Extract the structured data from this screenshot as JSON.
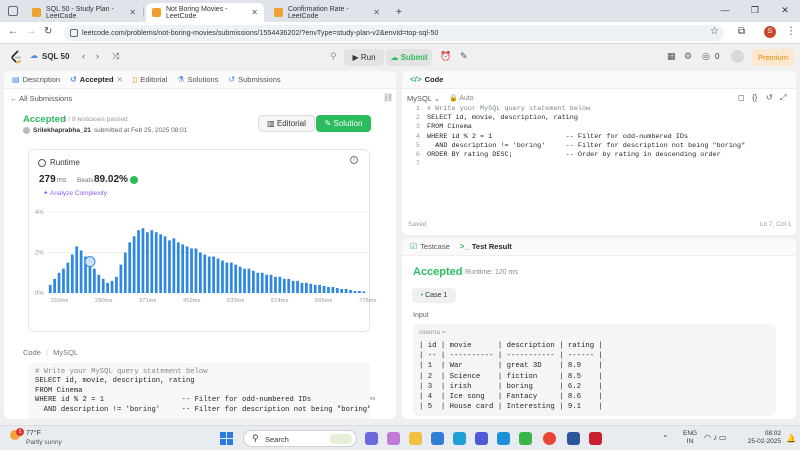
{
  "browser": {
    "tabs": [
      {
        "title": "SQL 50 - Study Plan - LeetCode",
        "active": false
      },
      {
        "title": "Not Boring Movies - LeetCode",
        "active": true
      },
      {
        "title": "Confirmation Rate - LeetCode",
        "active": false
      }
    ],
    "new_tab": "+",
    "url": "leetcode.com/problems/not-boring-movies/submissions/1554436202/?envType=study-plan-v2&envId=top-sql-50",
    "profile_initial": "S"
  },
  "header": {
    "study_plan": "SQL 50",
    "run_label": "Run",
    "submit_label": "Submit",
    "notif_count": "0",
    "premium_label": "Premium"
  },
  "left": {
    "tabs": [
      {
        "label": "Description",
        "icon": "description-icon"
      },
      {
        "label": "Accepted",
        "icon": "history-icon"
      },
      {
        "label": "Editorial",
        "icon": "editorial-icon"
      },
      {
        "label": "Solutions",
        "icon": "solutions-icon"
      },
      {
        "label": "Submissions",
        "icon": "submissions-icon"
      }
    ],
    "all_submissions": "All Submissions",
    "status": "Accepted",
    "passed": "8 / 8 testcases passed",
    "author": "Srilekhaprabha_21",
    "submitted_at": "submitted at Feb 25, 2025 08:01",
    "editorial_btn": "Editorial",
    "solution_btn": "Solution",
    "runtime_label": "Runtime",
    "runtime_value": "279",
    "runtime_unit": "ms",
    "beats_label": "Beats",
    "beats_value": "89.02%",
    "analyze": "Analyze Complexity",
    "code_label": "Code",
    "code_lang": "MySQL",
    "code_lines": [
      "# Write your MySQL query statement below",
      "SELECT id, movie, description, rating",
      "FROM Cinema",
      "WHERE id % 2 = 1                  -- Filter for odd-numbered IDs",
      "  AND description != 'boring'     -- Filter for description not being \"boring\""
    ]
  },
  "chart_data": {
    "type": "bar",
    "title": "",
    "xlabel": "",
    "ylabel": "",
    "ylim": [
      0,
      4
    ],
    "yticks": [
      "4%",
      "2%",
      "0%"
    ],
    "xticks": [
      "210ms",
      "290ms",
      "371ms",
      "452ms",
      "533ms",
      "614ms",
      "695ms",
      "776ms"
    ],
    "overview_ticks": [
      "210ms",
      "290ms",
      "371ms",
      "452ms",
      "533ms",
      "614ms",
      "695ms",
      "776ms"
    ],
    "highlight_index": 9,
    "values": [
      0.4,
      0.7,
      1.0,
      1.2,
      1.5,
      1.9,
      2.3,
      2.1,
      1.8,
      1.4,
      1.2,
      0.9,
      0.7,
      0.5,
      0.6,
      0.8,
      1.4,
      2.0,
      2.5,
      2.8,
      3.1,
      3.2,
      3.0,
      3.1,
      3.0,
      2.9,
      2.8,
      2.6,
      2.7,
      2.5,
      2.4,
      2.3,
      2.2,
      2.2,
      2.0,
      1.9,
      1.8,
      1.8,
      1.7,
      1.6,
      1.5,
      1.5,
      1.4,
      1.3,
      1.2,
      1.2,
      1.1,
      1.0,
      1.0,
      0.9,
      0.9,
      0.8,
      0.8,
      0.7,
      0.7,
      0.6,
      0.6,
      0.5,
      0.5,
      0.45,
      0.4,
      0.4,
      0.35,
      0.3,
      0.3,
      0.25,
      0.2,
      0.2,
      0.15,
      0.1,
      0.1,
      0.08
    ]
  },
  "editor": {
    "tab_label": "Code",
    "lang": "MySQL",
    "auto": "Auto",
    "lines": [
      "# Write your MySQL query statement below",
      "SELECT id, movie, description, rating",
      "FROM Cinema",
      "WHERE id % 2 = 1                  -- Filter for odd-numbered IDs",
      "  AND description != 'boring'     -- Filter for description not being \"boring\"",
      "ORDER BY rating DESC;             -- Order by rating in descending order",
      ""
    ],
    "saved": "Saved",
    "position": "Ln 7, Col 1"
  },
  "testcase": {
    "tab_testcase": "Testcase",
    "tab_result": "Test Result",
    "status": "Accepted",
    "runtime": "Runtime: 120 ms",
    "case_label": "Case 1",
    "input_label": "Input",
    "table_name": "cinema =",
    "table_lines": [
      "| id | movie      | description | rating |",
      "| -- | ---------- | ----------- | ------ |",
      "| 1  | War        | great 3D    | 8.9    |",
      "| 2  | Science    | fiction     | 8.5    |",
      "| 3  | irish      | boring      | 6.2    |",
      "| 4  | Ice song   | Fantacy     | 8.6    |",
      "| 5  | House card | Interesting | 9.1    |"
    ]
  },
  "taskbar": {
    "temperature": "77°F",
    "weather": "Partly sunny",
    "search_label": "Search",
    "lang_line1": "ENG",
    "lang_line2": "IN",
    "time": "08:02",
    "date": "25-02-2025",
    "badge": "1"
  },
  "colors": {
    "accent_green": "#2cbb5d",
    "bar_blue": "#2f88e0",
    "premium_orange": "#e08a00"
  }
}
